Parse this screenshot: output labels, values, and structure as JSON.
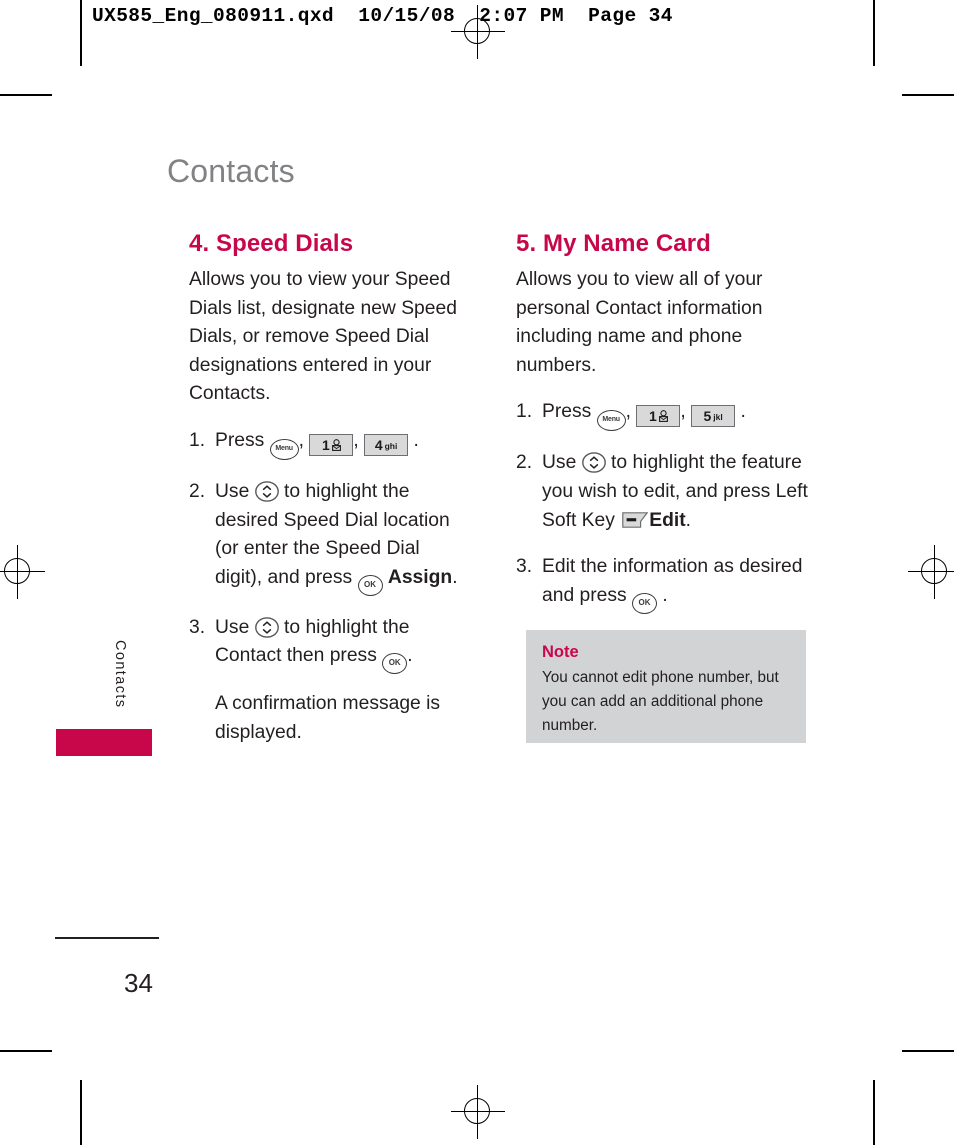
{
  "print": {
    "imposition_header": "UX585_Eng_080911.qxd  10/15/08  2:07 PM  Page 34"
  },
  "page": {
    "chapter_title": "Contacts",
    "side_tab_label": "Contacts",
    "page_number": "34",
    "accent_color": "#c8074b",
    "chapter_title_color": "#808285",
    "note_background_color": "#d2d3d5"
  },
  "left_column": {
    "heading": "4. Speed Dials",
    "intro": "Allows you to view your Speed Dials list, designate new Speed Dials, or remove Speed Dial designations entered in your Contacts.",
    "step1": {
      "number": "1.",
      "lead": "Press",
      "key_menu_label": "Menu",
      "key_1_digit": "1",
      "key_4_digit": "4",
      "key_4_letters": "ghi",
      "comma": ",",
      "period": "."
    },
    "step2": {
      "number": "2.",
      "lead": "Use",
      "text_after_nav": "to highlight the desired Speed Dial location (or enter the Speed Dial digit), and press",
      "key_ok_label": "OK",
      "emphasis": "Assign",
      "period": "."
    },
    "step3": {
      "number": "3.",
      "lead": "Use",
      "text_after_nav": "to highlight the Contact then press",
      "key_ok_label": "OK",
      "period": ".",
      "sub_text": "A confirmation message is displayed."
    }
  },
  "right_column": {
    "heading": "5. My Name Card",
    "intro": "Allows you to view all of your personal Contact information including name and phone numbers.",
    "step1": {
      "number": "1.",
      "lead": "Press",
      "key_menu_label": "Menu",
      "key_1_digit": "1",
      "key_5_digit": "5",
      "key_5_letters": "jkl",
      "comma": ",",
      "period": "."
    },
    "step2": {
      "number": "2.",
      "lead": "Use",
      "text_after_nav": "to highlight the feature you wish to edit, and press Left Soft Key",
      "emphasis": "Edit",
      "period": "."
    },
    "step3": {
      "number": "3.",
      "text": "Edit the information as desired and press",
      "key_ok_label": "OK",
      "period": "."
    },
    "note": {
      "title": "Note",
      "body": "You cannot edit phone number, but you can add an additional phone number."
    }
  }
}
